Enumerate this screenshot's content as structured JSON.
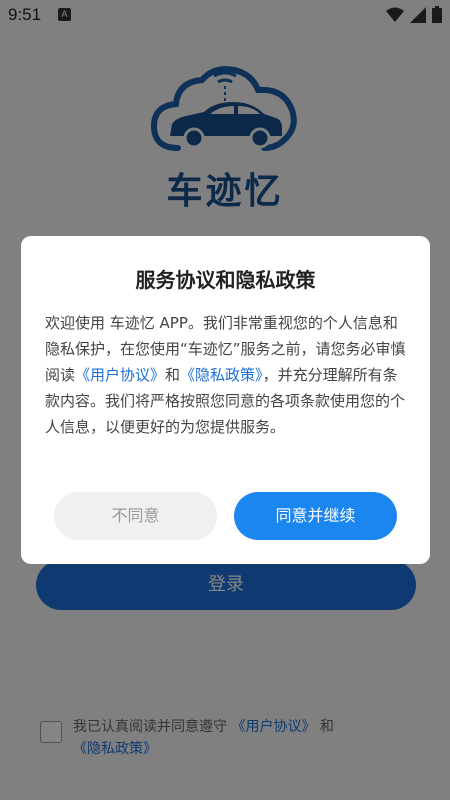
{
  "status_bar": {
    "time": "9:51",
    "notification_badge": "A",
    "icons": [
      "wifi-icon",
      "signal-icon",
      "battery-icon"
    ]
  },
  "app": {
    "name": "车迹忆",
    "logo": "car-cloud-logo"
  },
  "login": {
    "button_label": "登录"
  },
  "agreement": {
    "prefix": "我已认真阅读并同意遵守",
    "user_agreement": "《用户协议》",
    "and": "和",
    "privacy_policy": "《隐私政策》"
  },
  "dialog": {
    "title": "服务协议和隐私政策",
    "body_1": "欢迎使用 车迹忆 APP。我们非常重视您的个人信息和隐私保护，在您使用“车迹忆”服务之前，请您务必审慎阅读",
    "user_agreement": "《用户协议》",
    "and": "和",
    "privacy_policy": "《隐私政策》",
    "body_2": "，并充分理解所有条款内容。我们将严格按照您同意的各项条款使用您的个人信息，以便更好的为您提供服务。",
    "disagree_label": "不同意",
    "agree_label": "同意并继续"
  },
  "colors": {
    "brand": "#1a4f8f",
    "accent": "#1c86f0",
    "link": "#1c6fd8"
  }
}
